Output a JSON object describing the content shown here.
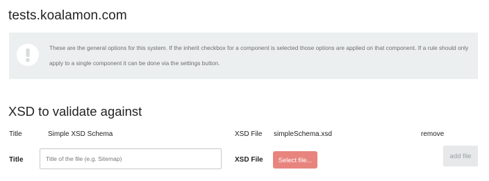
{
  "site": {
    "title": "tests.koalamon.com"
  },
  "info": {
    "icon": "exclamation-icon",
    "text": "These are the general options for this system. If the inherit checkbox for a component is selected those options are applied on that component. If a rule should only apply to a single component it can be done via the settings button."
  },
  "xsd": {
    "section_title": "XSD to validate against",
    "existing": {
      "title_label": "Title",
      "title_value": "Simple XSD Schema",
      "file_label": "XSD File",
      "file_value": "simpleSchema.xsd",
      "remove_label": "remove"
    },
    "new_entry": {
      "title_label": "Title",
      "title_placeholder": "Title of the file (e.g. Sitemap)",
      "file_label": "XSD File",
      "select_label": "Select file...",
      "add_label": "add file"
    }
  },
  "colors": {
    "info_background": "#eceff0",
    "select_button": "#e8847e",
    "add_button": "#e6e8e9"
  }
}
